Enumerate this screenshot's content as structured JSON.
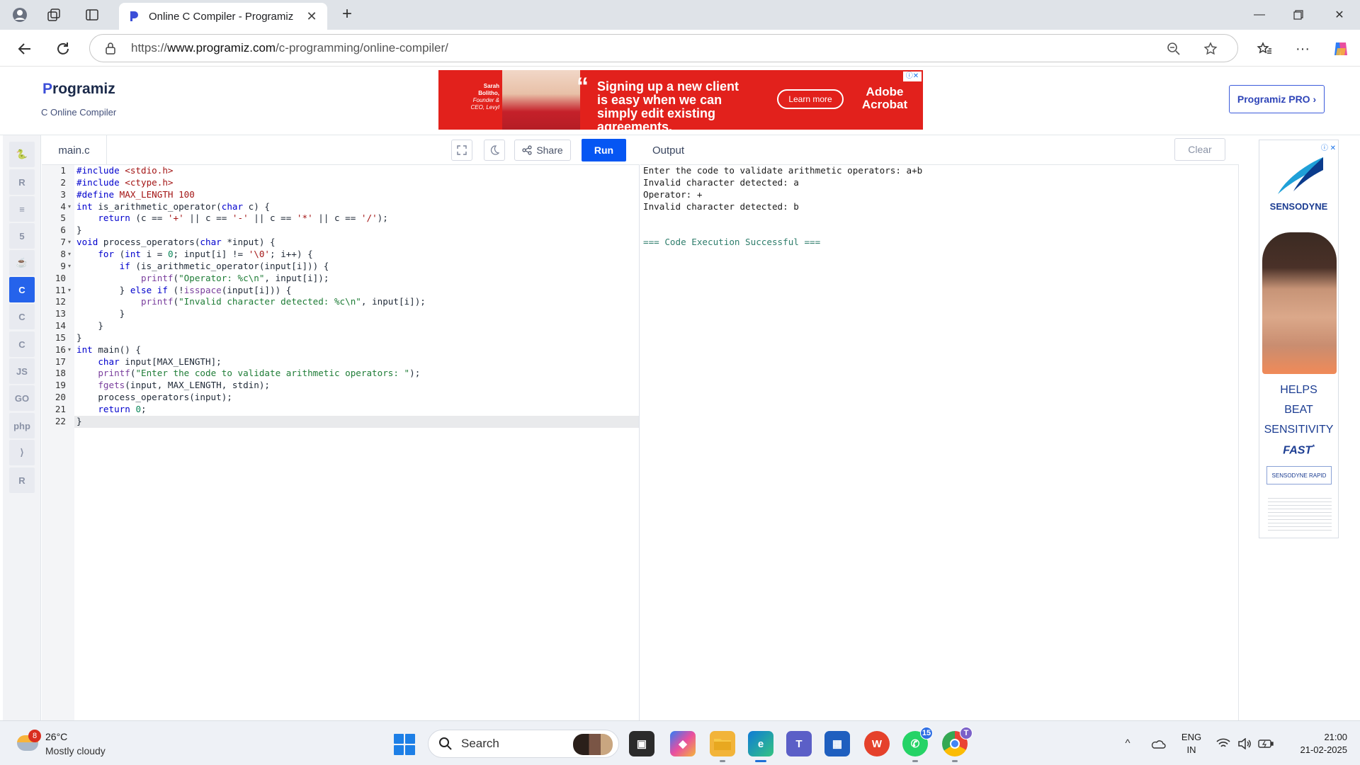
{
  "browser": {
    "tab_title": "Online C Compiler - Programiz",
    "url_prefix": "https://",
    "url_domain": "www.programiz.com",
    "url_path": "/c-programming/online-compiler/"
  },
  "header": {
    "logo_initial": "P",
    "logo_rest": "rogramiz",
    "subtitle": "C Online Compiler",
    "pro_button": "Programiz PRO ›"
  },
  "ad_banner": {
    "person_name": "Sarah Bolitho,",
    "person_role": "Founder & CEO, Levyl",
    "quote_mark": "“",
    "headline": "Signing up a new client is easy when we can simply edit existing agreements.",
    "cta": "Learn more",
    "brand": "Adobe Acrobat"
  },
  "sidebar": {
    "languages": [
      {
        "name": "python",
        "glyph": "🐍"
      },
      {
        "name": "r",
        "glyph": "R"
      },
      {
        "name": "sql",
        "glyph": "≡"
      },
      {
        "name": "html",
        "glyph": "5"
      },
      {
        "name": "java",
        "glyph": "☕"
      },
      {
        "name": "c",
        "glyph": "C"
      },
      {
        "name": "cpp",
        "glyph": "C"
      },
      {
        "name": "csharp",
        "glyph": "C"
      },
      {
        "name": "js",
        "glyph": "JS"
      },
      {
        "name": "go",
        "glyph": "GO"
      },
      {
        "name": "php",
        "glyph": "php"
      },
      {
        "name": "swift",
        "glyph": "⟩"
      },
      {
        "name": "rust",
        "glyph": "R"
      }
    ]
  },
  "editor": {
    "file_name": "main.c",
    "share_label": "Share",
    "run_label": "Run",
    "lines": [
      "#include <stdio.h>",
      "#include <ctype.h>",
      "#define MAX_LENGTH 100",
      "int is_arithmetic_operator(char c) {",
      "    return (c == '+' || c == '-' || c == '*' || c == '/');",
      "}",
      "void process_operators(char *input) {",
      "    for (int i = 0; input[i] != '\\0'; i++) {",
      "        if (is_arithmetic_operator(input[i])) {",
      "            printf(\"Operator: %c\\n\", input[i]);",
      "        } else if (!isspace(input[i])) {",
      "            printf(\"Invalid character detected: %c\\n\", input[i]);",
      "        }",
      "    }",
      "}",
      "int main() {",
      "    char input[MAX_LENGTH];",
      "    printf(\"Enter the code to validate arithmetic operators: \");",
      "    fgets(input, MAX_LENGTH, stdin);",
      "    process_operators(input);",
      "    return 0;",
      "}"
    ],
    "fold_lines": [
      4,
      7,
      8,
      9,
      11,
      16
    ],
    "active_line": 22
  },
  "output": {
    "title": "Output",
    "clear_label": "Clear",
    "lines": [
      "Enter the code to validate arithmetic operators: a+b",
      "Invalid character detected: a",
      "Operator: +",
      "Invalid character detected: b",
      "",
      "",
      "=== Code Execution Successful ==="
    ]
  },
  "right_ad": {
    "brand": "SENSODYNE",
    "line1": "HELPS",
    "line2": "BEAT",
    "line3": "SENSITIVITY",
    "line4": "FAST",
    "line4_mark": "*",
    "pack": "SENSODYNE  RAPID"
  },
  "taskbar": {
    "weather_badge": "8",
    "temperature": "26°C",
    "condition": "Mostly cloudy",
    "search_label": "Search",
    "whatsapp_badge": "15",
    "chrome_badge": "T",
    "lang_line1": "ENG",
    "lang_line2": "IN",
    "time": "21:00",
    "date": "21-02-2025"
  }
}
